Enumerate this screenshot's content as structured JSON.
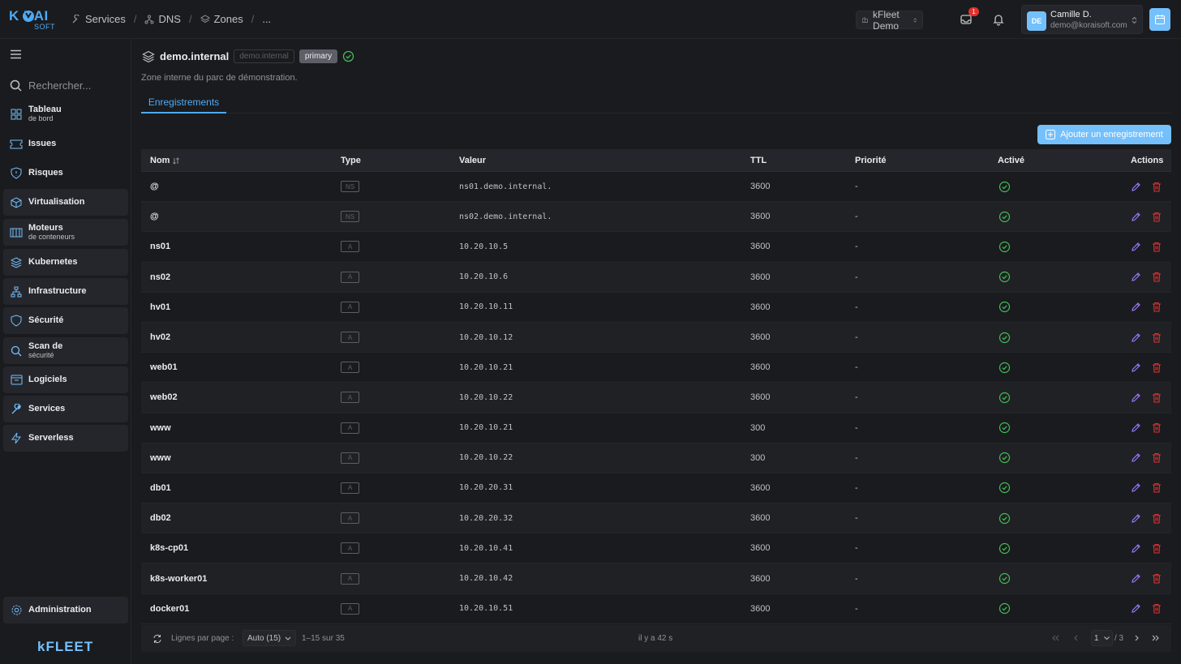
{
  "logo": {
    "top": "K  RAI",
    "bottom": "SOFT"
  },
  "breadcrumb": {
    "items": [
      "Services",
      "DNS",
      "Zones"
    ],
    "more": "...",
    "separator": "/"
  },
  "org": {
    "label": "kFleet Demo"
  },
  "notifications": {
    "inbox_count": "1"
  },
  "user": {
    "initials": "DE",
    "name": "Camille D.",
    "email": "demo@koraisoft.com"
  },
  "sidebar": {
    "search_placeholder": "Rechercher...",
    "items": [
      {
        "label": "Tableau",
        "sub": "de bord",
        "icon": "dashboard-icon"
      },
      {
        "label": "Issues",
        "sub": "",
        "icon": "ticket-icon"
      },
      {
        "label": "Risques",
        "sub": "",
        "icon": "shield-alert-icon"
      },
      {
        "label": "Virtualisation",
        "sub": "",
        "icon": "cube-icon"
      },
      {
        "label": "Moteurs",
        "sub": "de conteneurs",
        "icon": "container-icon"
      },
      {
        "label": "Kubernetes",
        "sub": "",
        "icon": "stack-icon"
      },
      {
        "label": "Infrastructure",
        "sub": "",
        "icon": "network-icon"
      },
      {
        "label": "Sécurité",
        "sub": "",
        "icon": "shield-icon"
      },
      {
        "label": "Scan de",
        "sub": "sécurité",
        "icon": "search-icon"
      },
      {
        "label": "Logiciels",
        "sub": "",
        "icon": "package-icon"
      },
      {
        "label": "Services",
        "sub": "",
        "icon": "tool-icon"
      },
      {
        "label": "Serverless",
        "sub": "",
        "icon": "bolt-icon"
      }
    ],
    "admin": "Administration",
    "brand": "kFLEET"
  },
  "zone": {
    "name": "demo.internal",
    "tag": "demo.internal",
    "role": "primary",
    "description": "Zone interne du parc de démonstration."
  },
  "tabs": {
    "records": "Enregistrements"
  },
  "add_button": "Ajouter un enregistrement",
  "table": {
    "headers": {
      "name": "Nom",
      "type": "Type",
      "value": "Valeur",
      "ttl": "TTL",
      "priority": "Priorité",
      "active": "Activé",
      "actions": "Actions"
    },
    "rows": [
      {
        "name": "@",
        "type": "NS",
        "value": "ns01.demo.internal.",
        "ttl": "3600",
        "priority": "-"
      },
      {
        "name": "@",
        "type": "NS",
        "value": "ns02.demo.internal.",
        "ttl": "3600",
        "priority": "-"
      },
      {
        "name": "ns01",
        "type": "A",
        "value": "10.20.10.5",
        "ttl": "3600",
        "priority": "-"
      },
      {
        "name": "ns02",
        "type": "A",
        "value": "10.20.10.6",
        "ttl": "3600",
        "priority": "-"
      },
      {
        "name": "hv01",
        "type": "A",
        "value": "10.20.10.11",
        "ttl": "3600",
        "priority": "-"
      },
      {
        "name": "hv02",
        "type": "A",
        "value": "10.20.10.12",
        "ttl": "3600",
        "priority": "-"
      },
      {
        "name": "web01",
        "type": "A",
        "value": "10.20.10.21",
        "ttl": "3600",
        "priority": "-"
      },
      {
        "name": "web02",
        "type": "A",
        "value": "10.20.10.22",
        "ttl": "3600",
        "priority": "-"
      },
      {
        "name": "www",
        "type": "A",
        "value": "10.20.10.21",
        "ttl": "300",
        "priority": "-"
      },
      {
        "name": "www",
        "type": "A",
        "value": "10.20.10.22",
        "ttl": "300",
        "priority": "-"
      },
      {
        "name": "db01",
        "type": "A",
        "value": "10.20.20.31",
        "ttl": "3600",
        "priority": "-"
      },
      {
        "name": "db02",
        "type": "A",
        "value": "10.20.20.32",
        "ttl": "3600",
        "priority": "-"
      },
      {
        "name": "k8s-cp01",
        "type": "A",
        "value": "10.20.10.41",
        "ttl": "3600",
        "priority": "-"
      },
      {
        "name": "k8s-worker01",
        "type": "A",
        "value": "10.20.10.42",
        "ttl": "3600",
        "priority": "-"
      },
      {
        "name": "docker01",
        "type": "A",
        "value": "10.20.10.51",
        "ttl": "3600",
        "priority": "-"
      }
    ]
  },
  "footer": {
    "rows_per_page_label": "Lignes par page :",
    "rows_per_page_value": "Auto (15)",
    "range": "1–15 sur 35",
    "updated": "il y a 42 s",
    "page": "1",
    "total_pages": "/ 3"
  },
  "colors": {
    "accent": "#4dabf7",
    "success": "#40c057",
    "danger": "#e03131",
    "edit": "#9775fa"
  }
}
